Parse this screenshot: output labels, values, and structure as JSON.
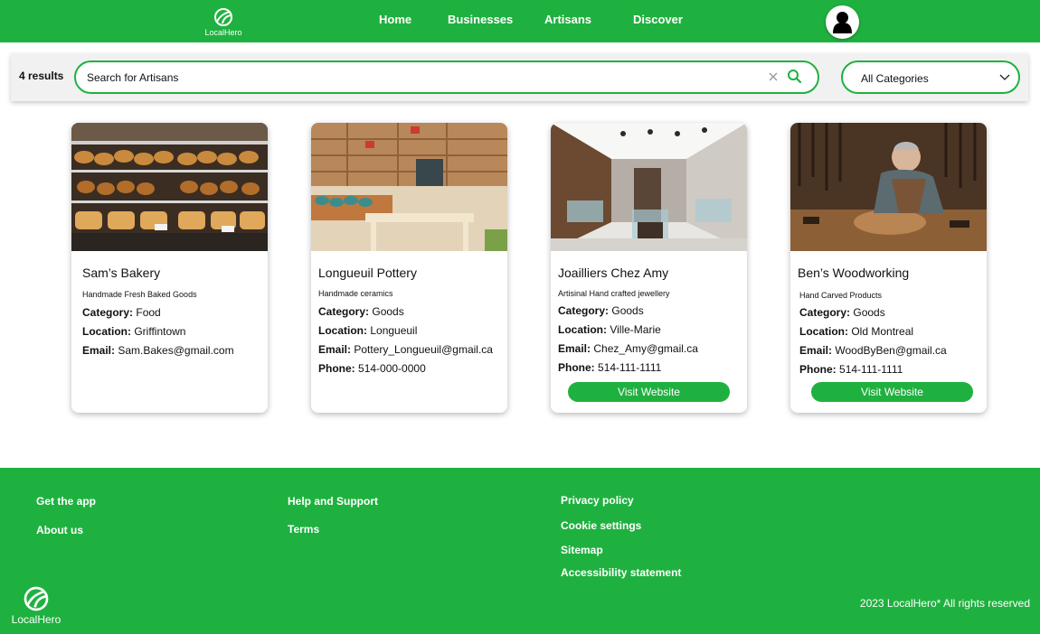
{
  "brand": {
    "name": "LocalHero"
  },
  "nav": {
    "items": [
      {
        "label": "Home"
      },
      {
        "label": "Businesses"
      },
      {
        "label": "Artisans"
      },
      {
        "label": "Discover"
      }
    ]
  },
  "search": {
    "results_count": "4 results",
    "query": "Search for Artisans",
    "category": "All Categories"
  },
  "field_labels": {
    "category": "Category:",
    "location": "Location:",
    "email": "Email:",
    "phone": "Phone:"
  },
  "cards": [
    {
      "name": "Sam’s Bakery",
      "description": "Handmade Fresh Baked Goods",
      "category": "Food",
      "location": "Griffintown",
      "email": "Sam.Bakes@gmail.com"
    },
    {
      "name": "Longueuil Pottery",
      "description": "Handmade ceramics",
      "category": "Goods",
      "location": "Longueuil",
      "email": "Pottery_Longueuil@gmail.ca",
      "phone": "514-000-0000"
    },
    {
      "name": "Joailliers Chez Amy",
      "description": "Artisinal Hand crafted jewellery",
      "category": "Goods",
      "location": "Ville-Marie",
      "email": "Chez_Amy@gmail.ca",
      "phone": "514-111-1111",
      "button": "Visit Website"
    },
    {
      "name": "Ben’s Woodworking",
      "description": "Hand Carved Products",
      "category": "Goods",
      "location": "Old Montreal",
      "email": "WoodByBen@gmail.ca",
      "phone": "514-111-1111",
      "button": "Visit Website"
    }
  ],
  "footer": {
    "col1": [
      "Get the app",
      "About us"
    ],
    "col2": [
      "Help and Support",
      "Terms"
    ],
    "col3": [
      "Privacy policy",
      "Cookie settings",
      "Sitemap",
      "Accessibility statement"
    ],
    "copyright": "2023 LocalHero* All rights reserved"
  },
  "colors": {
    "brand_green": "#1fb13f",
    "search_bar_bg": "#f1f1f1"
  },
  "icons": [
    "localhero-logo-icon",
    "avatar-icon",
    "clear-icon",
    "search-icon",
    "chevron-down-icon"
  ]
}
